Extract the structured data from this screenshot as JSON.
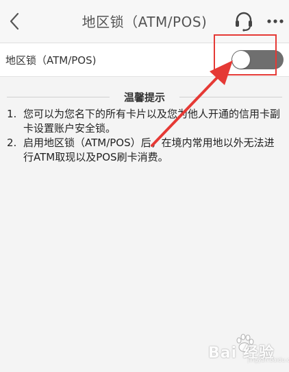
{
  "header": {
    "title": "地区锁（ATM/POS)",
    "back_icon": "chevron-left-icon",
    "support_icon": "headset-icon",
    "more_icon": "more-dots-icon"
  },
  "setting": {
    "label": "地区锁（ATM/POS)",
    "toggle_on": false
  },
  "tips": {
    "title": "温馨提示",
    "items": [
      {
        "num": "1.",
        "text": "您可以为您名下的所有卡片以及您为他人开通的信用卡副卡设置账户安全锁。"
      },
      {
        "num": "2.",
        "text": "启用地区锁（ATM/POS）后，在境内常用地以外无法进行ATM取现以及POS刷卡消费。"
      }
    ]
  },
  "annotation": {
    "color": "#e53935"
  },
  "watermark": {
    "text": "Bai 经验",
    "sub": "jingyan.baidu.com"
  }
}
